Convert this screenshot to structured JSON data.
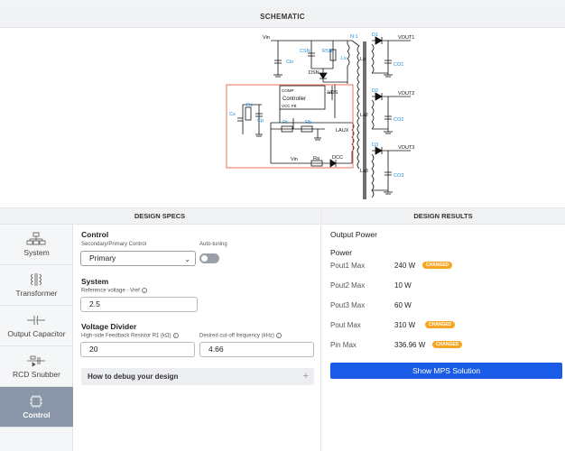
{
  "schematic": {
    "header": "SCHEMATIC",
    "labels": {
      "vin": "Vin",
      "cin": "Cin",
      "csn": "CSN",
      "rsn": "RSN",
      "ls": "Ls",
      "dsn": "DSN",
      "nratio": "N:1",
      "lp": "Lp",
      "d1": "D1",
      "vout1": "VOUT1",
      "co1": "CO1",
      "comp": "COMP",
      "controller": "Controller",
      "vcc_fb": "VCC   FB",
      "vds": "VDS",
      "cs": "Cs",
      "rs": "Rs",
      "cp": "Cp",
      "rt": "Rt",
      "rb": "Rb",
      "d2": "D2",
      "vout2": "VOUT2",
      "ls2": "Ls2",
      "co2": "CO2",
      "laux": "LAUX",
      "vin2": "Vin",
      "ra": "Ra",
      "dcc": "DCC",
      "d3": "D3",
      "vout3": "VOUT3",
      "ls3": "Ls3",
      "co3": "CO3"
    }
  },
  "design_specs": {
    "header": "DESIGN SPECS",
    "nav": [
      {
        "label": "System",
        "icon": "system-icon"
      },
      {
        "label": "Transformer",
        "icon": "transformer-icon"
      },
      {
        "label": "Output Capacitor",
        "icon": "capacitor-icon"
      },
      {
        "label": "RCD Snubber",
        "icon": "snubber-icon"
      },
      {
        "label": "Control",
        "icon": "chip-icon",
        "active": true
      }
    ],
    "control": {
      "title": "Control",
      "mode_label": "Secondary/Primary Control",
      "mode_value": "Primary",
      "autotune_label": "Auto-tuning"
    },
    "system": {
      "title": "System",
      "vref_label": "Reference voltage - Vref",
      "vref_value": "2.5"
    },
    "divider": {
      "title": "Voltage Divider",
      "r1_label": "High-side Feedback Resistor R1 (kΩ)",
      "r1_value": "20",
      "freq_label": "Desired cut-off frequency (kHz)",
      "freq_value": "4.66"
    },
    "debug_label": "How to debug your design",
    "debug_plus": "+"
  },
  "design_results": {
    "header": "DESIGN RESULTS",
    "output_power_title": "Output Power",
    "power_title": "Power",
    "rows": [
      {
        "key": "Pout1 Max",
        "value": "240 W",
        "badge": "CHANGED"
      },
      {
        "key": "Pout2 Max",
        "value": "10 W",
        "badge": ""
      },
      {
        "key": "Pout3 Max",
        "value": "60 W",
        "badge": ""
      },
      {
        "key": "Pout Max",
        "value": "310 W",
        "badge": "CHANGED"
      },
      {
        "key": "Pin Max",
        "value": "336.96 W",
        "badge": "CHANGED"
      }
    ],
    "button_label": "Show MPS Solution"
  },
  "colors": {
    "accent_blue": "#1a5ce8",
    "badge_orange": "#f6a623",
    "highlight_red": "#e8735a",
    "label_blue": "#1f8fd6",
    "sidebar_active": "#8896a8"
  }
}
